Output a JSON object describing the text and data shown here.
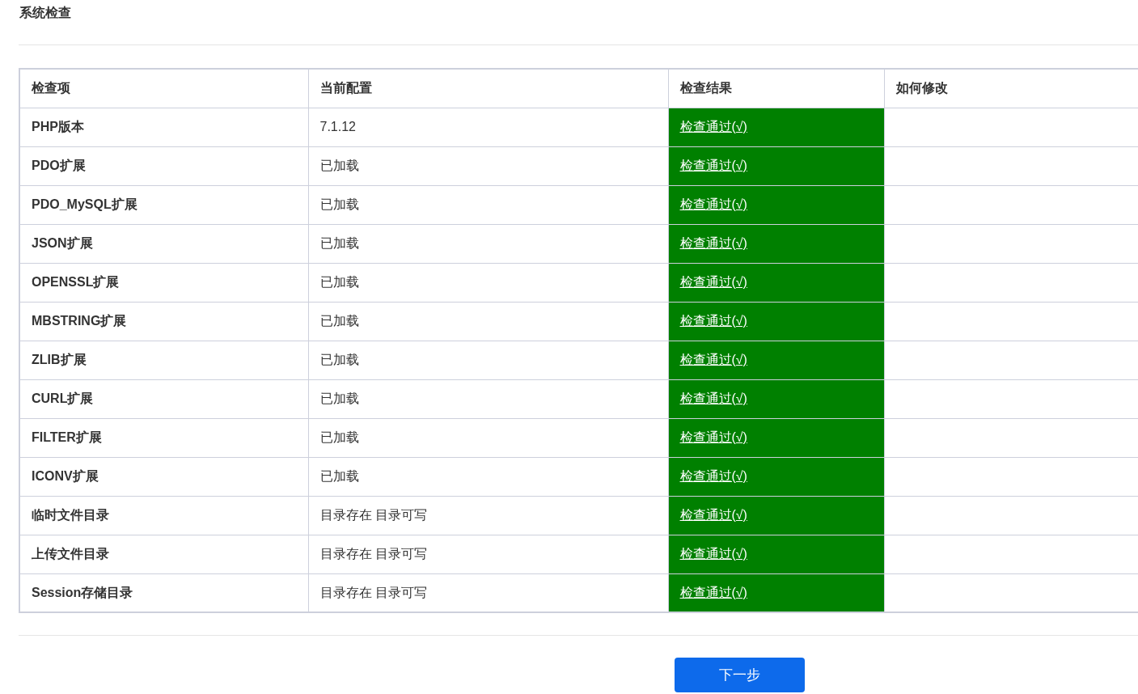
{
  "title": "系统检查",
  "table": {
    "columns": [
      "检查项",
      "当前配置",
      "检查结果",
      "如何修改"
    ],
    "rows": [
      {
        "item": "PHP版本",
        "config": "7.1.12",
        "result": "检查通过(√)",
        "passed": true
      },
      {
        "item": "PDO扩展",
        "config": "已加载",
        "result": "检查通过(√)",
        "passed": true
      },
      {
        "item": "PDO_MySQL扩展",
        "config": "已加载",
        "result": "检查通过(√)",
        "passed": true
      },
      {
        "item": "JSON扩展",
        "config": "已加载",
        "result": "检查通过(√)",
        "passed": true
      },
      {
        "item": "OPENSSL扩展",
        "config": "已加载",
        "result": "检查通过(√)",
        "passed": true
      },
      {
        "item": "MBSTRING扩展",
        "config": "已加载",
        "result": "检查通过(√)",
        "passed": true
      },
      {
        "item": "ZLIB扩展",
        "config": "已加载",
        "result": "检查通过(√)",
        "passed": true
      },
      {
        "item": "CURL扩展",
        "config": "已加载",
        "result": "检查通过(√)",
        "passed": true
      },
      {
        "item": "FILTER扩展",
        "config": "已加载",
        "result": "检查通过(√)",
        "passed": true
      },
      {
        "item": "ICONV扩展",
        "config": "已加载",
        "result": "检查通过(√)",
        "passed": true
      },
      {
        "item": "临时文件目录",
        "config": "目录存在 目录可写",
        "result": "检查通过(√)",
        "passed": true
      },
      {
        "item": "上传文件目录",
        "config": "目录存在 目录可写",
        "result": "检查通过(√)",
        "passed": true
      },
      {
        "item": "Session存储目录",
        "config": "目录存在 目录可写",
        "result": "检查通过(√)",
        "passed": true
      }
    ]
  },
  "next_button": "下一步"
}
